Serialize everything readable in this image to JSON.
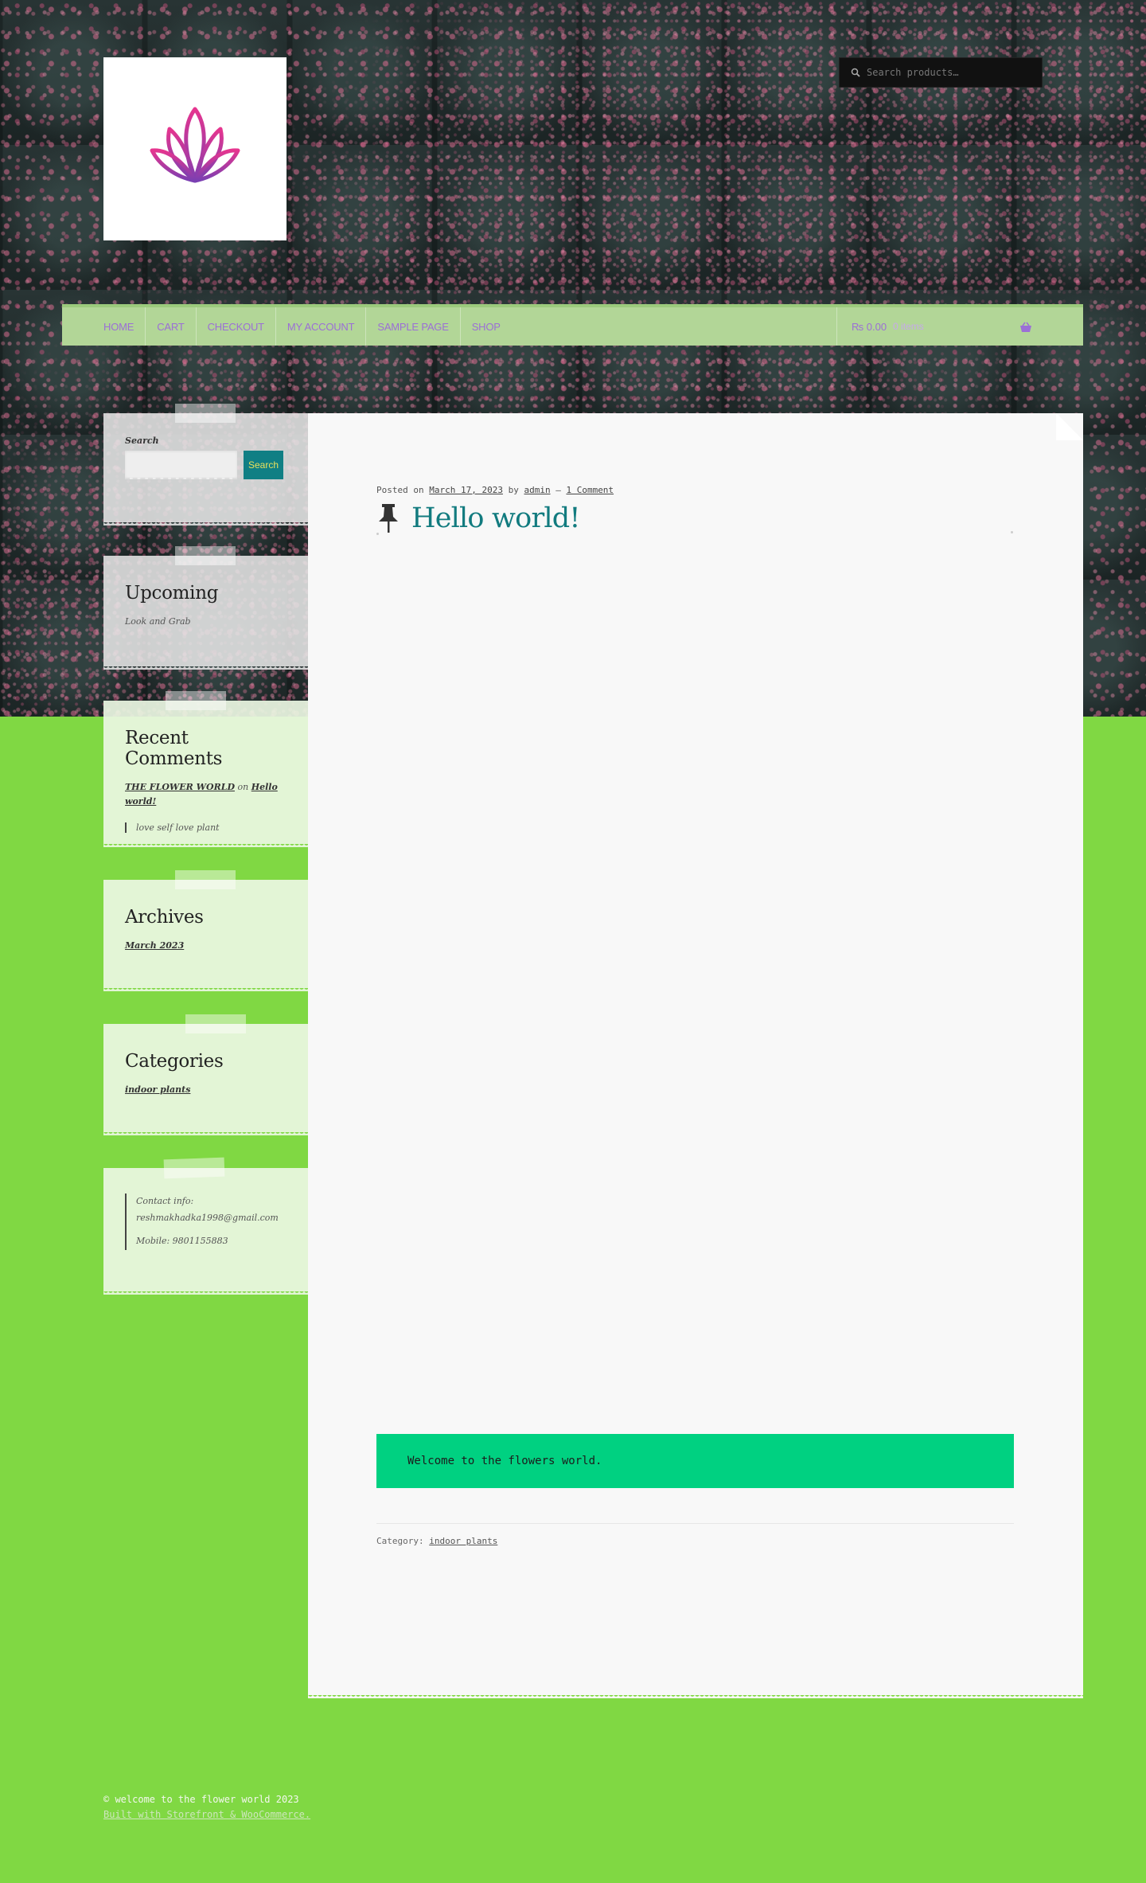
{
  "header": {
    "search_placeholder": "Search products…"
  },
  "nav": {
    "items": [
      {
        "label": "HOME"
      },
      {
        "label": "CART"
      },
      {
        "label": "CHECKOUT"
      },
      {
        "label": "MY ACCOUNT"
      },
      {
        "label": "SAMPLE PAGE"
      },
      {
        "label": "SHOP"
      }
    ],
    "cart_amount": "₨ 0.00",
    "cart_count": "0 items"
  },
  "sidebar": {
    "search": {
      "label": "Search",
      "button": "Search"
    },
    "upcoming": {
      "title": "Upcoming",
      "text": "Look and Grab"
    },
    "recent_comments": {
      "title": "Recent Comments",
      "author": "THE FLOWER WORLD",
      "on": "on",
      "post": "Hello world!",
      "quote": "love self love plant"
    },
    "archives": {
      "title": "Archives",
      "item": "March 2023"
    },
    "categories": {
      "title": "Categories",
      "item": "indoor plants"
    },
    "contact": {
      "line1": "Contact info:",
      "line2": "reshmakhadka1998@gmail.com",
      "line3": "Mobile: 9801155883"
    }
  },
  "post": {
    "posted_on": "Posted on",
    "date": "March 17, 2023",
    "by": "by",
    "author": "admin",
    "dash": "—",
    "comments": "1 Comment",
    "title": "Hello world!",
    "body": "Welcome to the flowers world.",
    "category_label": "Category:",
    "category": "indoor plants"
  },
  "footer": {
    "copyright": "© welcome to the flower world 2023",
    "credit": "Built with Storefront & WooCommerce."
  },
  "colors": {
    "page_background": "#80d843",
    "nav_background": "#b2d697",
    "nav_text": "#9b6fd6",
    "title_teal": "#127b7f",
    "welcome_box": "#00d181",
    "search_button": "#107f84"
  }
}
